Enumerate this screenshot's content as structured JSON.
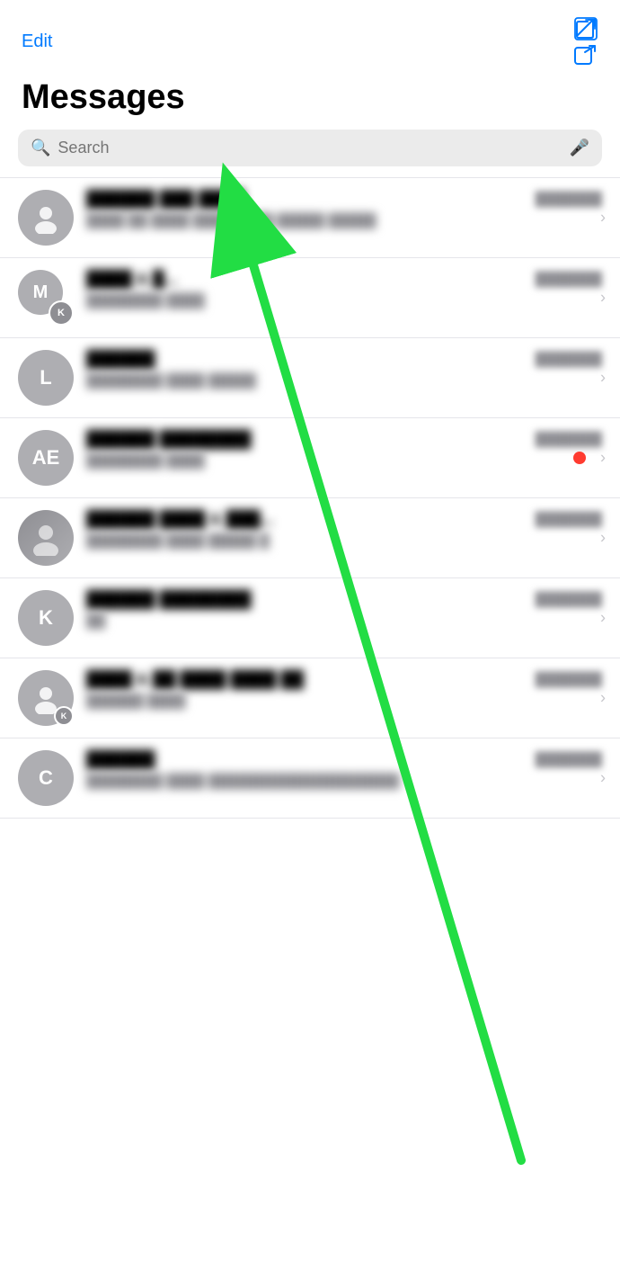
{
  "header": {
    "edit_label": "Edit",
    "title": "Messages",
    "search_placeholder": "Search"
  },
  "conversations": [
    {
      "id": 1,
      "avatar_type": "person",
      "initials": "",
      "name": "██████ ███ ████",
      "time": "███████",
      "preview": "████ ██ ████\n██████ ██ █████ █████",
      "has_notif": false
    },
    {
      "id": 2,
      "avatar_type": "group",
      "main_initial": "M",
      "sub_initial": "K",
      "name": "████ & █...",
      "time": "███████",
      "preview": "████████ ████",
      "has_notif": false
    },
    {
      "id": 3,
      "avatar_type": "initial",
      "initials": "L",
      "name": "██████",
      "time": "███████",
      "preview": "████████ ████ █████",
      "has_notif": false
    },
    {
      "id": 4,
      "avatar_type": "initial",
      "initials": "AE",
      "name": "██████ ████████",
      "time": "███████",
      "preview": "████████ ████",
      "has_notif": true
    },
    {
      "id": 5,
      "avatar_type": "photo",
      "initials": "",
      "name": "██████ ████ & ███...",
      "time": "███████",
      "preview": "████████ ████\n█████ █",
      "has_notif": false
    },
    {
      "id": 6,
      "avatar_type": "initial",
      "initials": "K",
      "name": "██████ ████████",
      "time": "███████",
      "preview": "██",
      "has_notif": false
    },
    {
      "id": 7,
      "avatar_type": "person_badge",
      "initials": "",
      "sub_initial": "K",
      "name": "████ & ██ ████ ████ ██",
      "time": "███████",
      "preview": "██████ ████",
      "has_notif": false
    },
    {
      "id": 8,
      "avatar_type": "initial",
      "initials": "C",
      "name": "██████",
      "time": "███████",
      "preview": "████████ ████\n████████████████████",
      "has_notif": false
    }
  ]
}
